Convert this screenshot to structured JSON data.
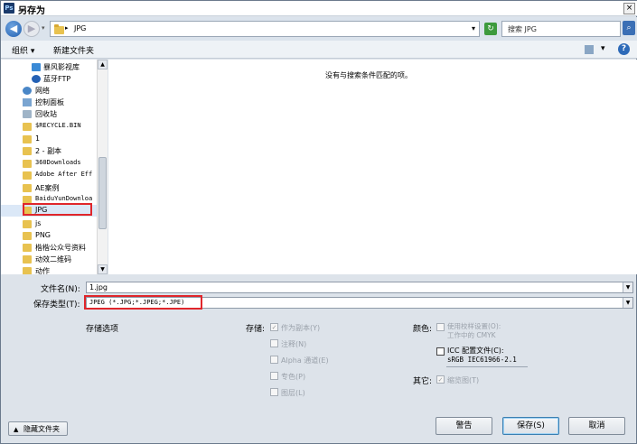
{
  "window": {
    "title": "另存为",
    "app_icon": "Ps",
    "close": "×"
  },
  "address": {
    "path_sep": "▸",
    "path": "JPG",
    "search_placeholder": "搜索 JPG"
  },
  "toolbar": {
    "organize": "组织 ▾",
    "new_folder": "新建文件夹",
    "view": "▾",
    "help": "?"
  },
  "nav": {
    "items": [
      {
        "label": "暴风影视库",
        "icon": "media-library-icon"
      },
      {
        "label": "蓝牙FTP",
        "icon": "bluetooth-icon"
      },
      {
        "label": "网络",
        "icon": "network-icon"
      },
      {
        "label": "控制面板",
        "icon": "control-panel-icon"
      },
      {
        "label": "回收站",
        "icon": "recycle-bin-icon"
      },
      {
        "label": "$RECYCLE.BIN",
        "icon": "folder-icon"
      },
      {
        "label": "1",
        "icon": "folder-icon"
      },
      {
        "label": "2 - 副本",
        "icon": "folder-icon"
      },
      {
        "label": "360Downloads",
        "icon": "folder-icon"
      },
      {
        "label": "Adobe After Eff",
        "icon": "folder-icon"
      },
      {
        "label": "AE案例",
        "icon": "folder-icon"
      },
      {
        "label": "BaiduYunDownloa",
        "icon": "folder-icon"
      },
      {
        "label": "JPG",
        "icon": "folder-icon"
      },
      {
        "label": "js",
        "icon": "folder-icon"
      },
      {
        "label": "PNG",
        "icon": "folder-icon"
      },
      {
        "label": "楷楷公众号资料",
        "icon": "folder-icon"
      },
      {
        "label": "动效二维码",
        "icon": "folder-icon"
      },
      {
        "label": "动作",
        "icon": "folder-icon"
      }
    ]
  },
  "content": {
    "empty_message": "没有与搜索条件匹配的项。"
  },
  "form": {
    "filename_label": "文件名(N):",
    "filename_value": "1.jpg",
    "type_label": "保存类型(T):",
    "type_value": "JPEG (*.JPG;*.JPEG;*.JPE)"
  },
  "options": {
    "storage_options": "存储选项",
    "store_label": "存储:",
    "store_items": [
      "作为副本(Y)",
      "注释(N)",
      "Alpha 通道(E)",
      "专色(P)",
      "图层(L)"
    ],
    "color_label": "颜色:",
    "proof_setup": "使用校样设置(O):",
    "proof_sub": "工作中的 CMYK",
    "icc_label": "ICC 配置文件(C):",
    "icc_value": "sRGB IEC61966-2.1",
    "other_label": "其它:",
    "thumbnail": "缩览图(T)"
  },
  "footer": {
    "hide_folders": "隐藏文件夹",
    "warning": "警告",
    "save": "保存(S)",
    "cancel": "取消"
  }
}
